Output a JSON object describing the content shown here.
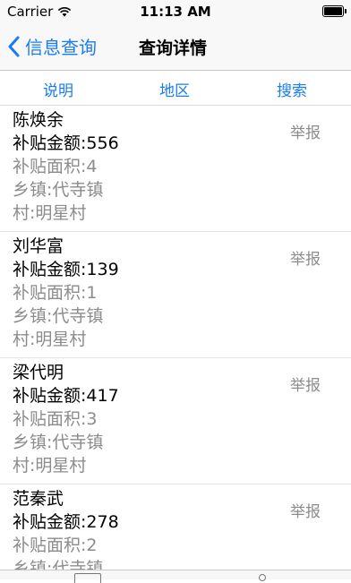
{
  "status_bar": {
    "carrier": "Carrier",
    "time": "11:13 AM"
  },
  "nav_bar": {
    "back_label": "信息查询",
    "title": "查询详情"
  },
  "tabs": [
    {
      "label": "说明"
    },
    {
      "label": "地区"
    },
    {
      "label": "搜索"
    }
  ],
  "records": [
    {
      "name": "陈焕余",
      "amount": "补贴金额:556",
      "area": "补贴面积:4",
      "town": "乡镇:代寺镇",
      "village": "村:明星村",
      "report": "举报"
    },
    {
      "name": "刘华富",
      "amount": "补贴金额:139",
      "area": "补贴面积:1",
      "town": "乡镇:代寺镇",
      "village": "村:明星村",
      "report": "举报"
    },
    {
      "name": "梁代明",
      "amount": "补贴金额:417",
      "area": "补贴面积:3",
      "town": "乡镇:代寺镇",
      "village": "村:明星村",
      "report": "举报"
    },
    {
      "name": "范秦武",
      "amount": "补贴金额:278",
      "area": "补贴面积:2",
      "town": "乡镇:代寺镇",
      "village": "",
      "report": "举报"
    }
  ],
  "colors": {
    "accent": "#1a7cf5",
    "secondary_text": "#8c8c8c"
  },
  "icons": {
    "wifi": "wifi-icon",
    "battery": "battery-icon",
    "back": "chevron-left-icon"
  }
}
